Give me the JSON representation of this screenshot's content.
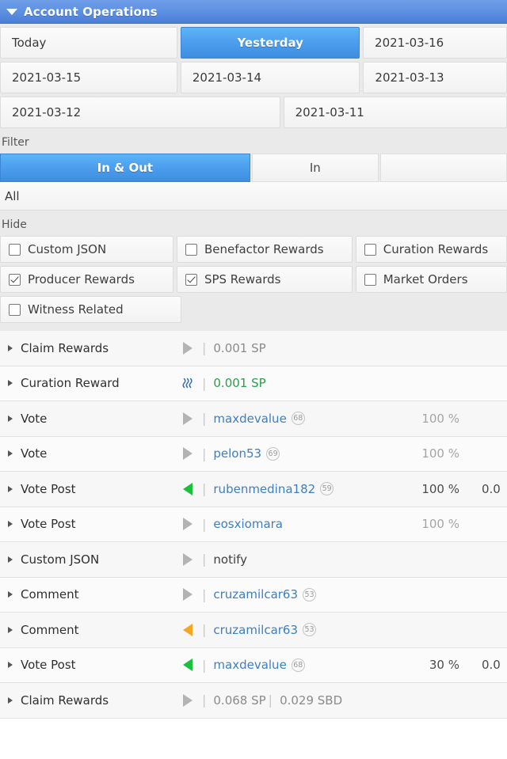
{
  "titlebar": {
    "icon": "caret-down-icon",
    "title": "Account Operations"
  },
  "dates": {
    "rows": [
      [
        {
          "label": "Today",
          "active": false
        },
        {
          "label": "Yesterday",
          "active": true
        },
        {
          "label": "2021-03-16",
          "active": false
        }
      ],
      [
        {
          "label": "2021-03-15",
          "active": false
        },
        {
          "label": "2021-03-14",
          "active": false
        },
        {
          "label": "2021-03-13",
          "active": false
        }
      ],
      [
        {
          "label": "2021-03-12",
          "active": false
        },
        {
          "label": "2021-03-11",
          "active": false
        }
      ]
    ]
  },
  "filter": {
    "label": "Filter",
    "options": [
      {
        "label": "In & Out",
        "active": true
      },
      {
        "label": "In",
        "active": false
      },
      {
        "label": "",
        "active": false
      }
    ],
    "all_label": "All"
  },
  "hide": {
    "label": "Hide",
    "items": [
      {
        "label": "Custom JSON",
        "checked": false
      },
      {
        "label": "Benefactor Rewards",
        "checked": false
      },
      {
        "label": "Curation Rewards",
        "checked": false
      },
      {
        "label": "Producer Rewards",
        "checked": true
      },
      {
        "label": "SPS Rewards",
        "checked": true
      },
      {
        "label": "Market Orders",
        "checked": false
      },
      {
        "label": "Witness Related",
        "checked": false
      }
    ]
  },
  "operations": [
    {
      "type": "Claim Rewards",
      "direction": "right-gray",
      "amount": "0.001 SP",
      "amount_color": "gray",
      "username": "",
      "rep": "",
      "pct": "",
      "tail": ""
    },
    {
      "type": "Curation Reward",
      "direction": "steem-logo",
      "amount": "0.001 SP",
      "amount_color": "green",
      "username": "",
      "rep": "",
      "pct": "",
      "tail": ""
    },
    {
      "type": "Vote",
      "direction": "right-gray",
      "amount": "",
      "amount_color": "",
      "username": "maxdevalue",
      "rep": "68",
      "pct": "100 %",
      "pct_strong": false,
      "tail": ""
    },
    {
      "type": "Vote",
      "direction": "right-gray",
      "amount": "",
      "amount_color": "",
      "username": "pelon53",
      "rep": "69",
      "pct": "100 %",
      "pct_strong": false,
      "tail": ""
    },
    {
      "type": "Vote Post",
      "direction": "left-green",
      "amount": "",
      "amount_color": "",
      "username": "rubenmedina182",
      "rep": "59",
      "pct": "100 %",
      "pct_strong": true,
      "tail": "0.0"
    },
    {
      "type": "Vote Post",
      "direction": "right-gray",
      "amount": "",
      "amount_color": "",
      "username": "eosxiomara",
      "rep": "",
      "pct": "100 %",
      "pct_strong": false,
      "tail": ""
    },
    {
      "type": "Custom JSON",
      "direction": "right-gray",
      "amount": "",
      "amount_color": "",
      "plain": "notify",
      "username": "",
      "rep": "",
      "pct": "",
      "tail": ""
    },
    {
      "type": "Comment",
      "direction": "right-gray",
      "amount": "",
      "amount_color": "",
      "username": "cruzamilcar63",
      "rep": "53",
      "pct": "",
      "tail": ""
    },
    {
      "type": "Comment",
      "direction": "left-orange",
      "amount": "",
      "amount_color": "",
      "username": "cruzamilcar63",
      "rep": "53",
      "pct": "",
      "tail": ""
    },
    {
      "type": "Vote Post",
      "direction": "left-green",
      "amount": "",
      "amount_color": "",
      "username": "maxdevalue",
      "rep": "68",
      "pct": "30 %",
      "pct_strong": true,
      "tail": "0.0"
    },
    {
      "type": "Claim Rewards",
      "direction": "right-gray",
      "amount": "0.068 SP",
      "amount2": "0.029 SBD",
      "amount_color": "gray",
      "username": "",
      "rep": "",
      "pct": "",
      "tail": ""
    }
  ],
  "colors": {
    "accent_blue": "#4e9fee",
    "link_blue": "#3d7fc1",
    "green": "#2a9e4b",
    "arrow_green": "#19c03a",
    "arrow_orange": "#f5a623",
    "arrow_gray": "#b3b3b3"
  }
}
